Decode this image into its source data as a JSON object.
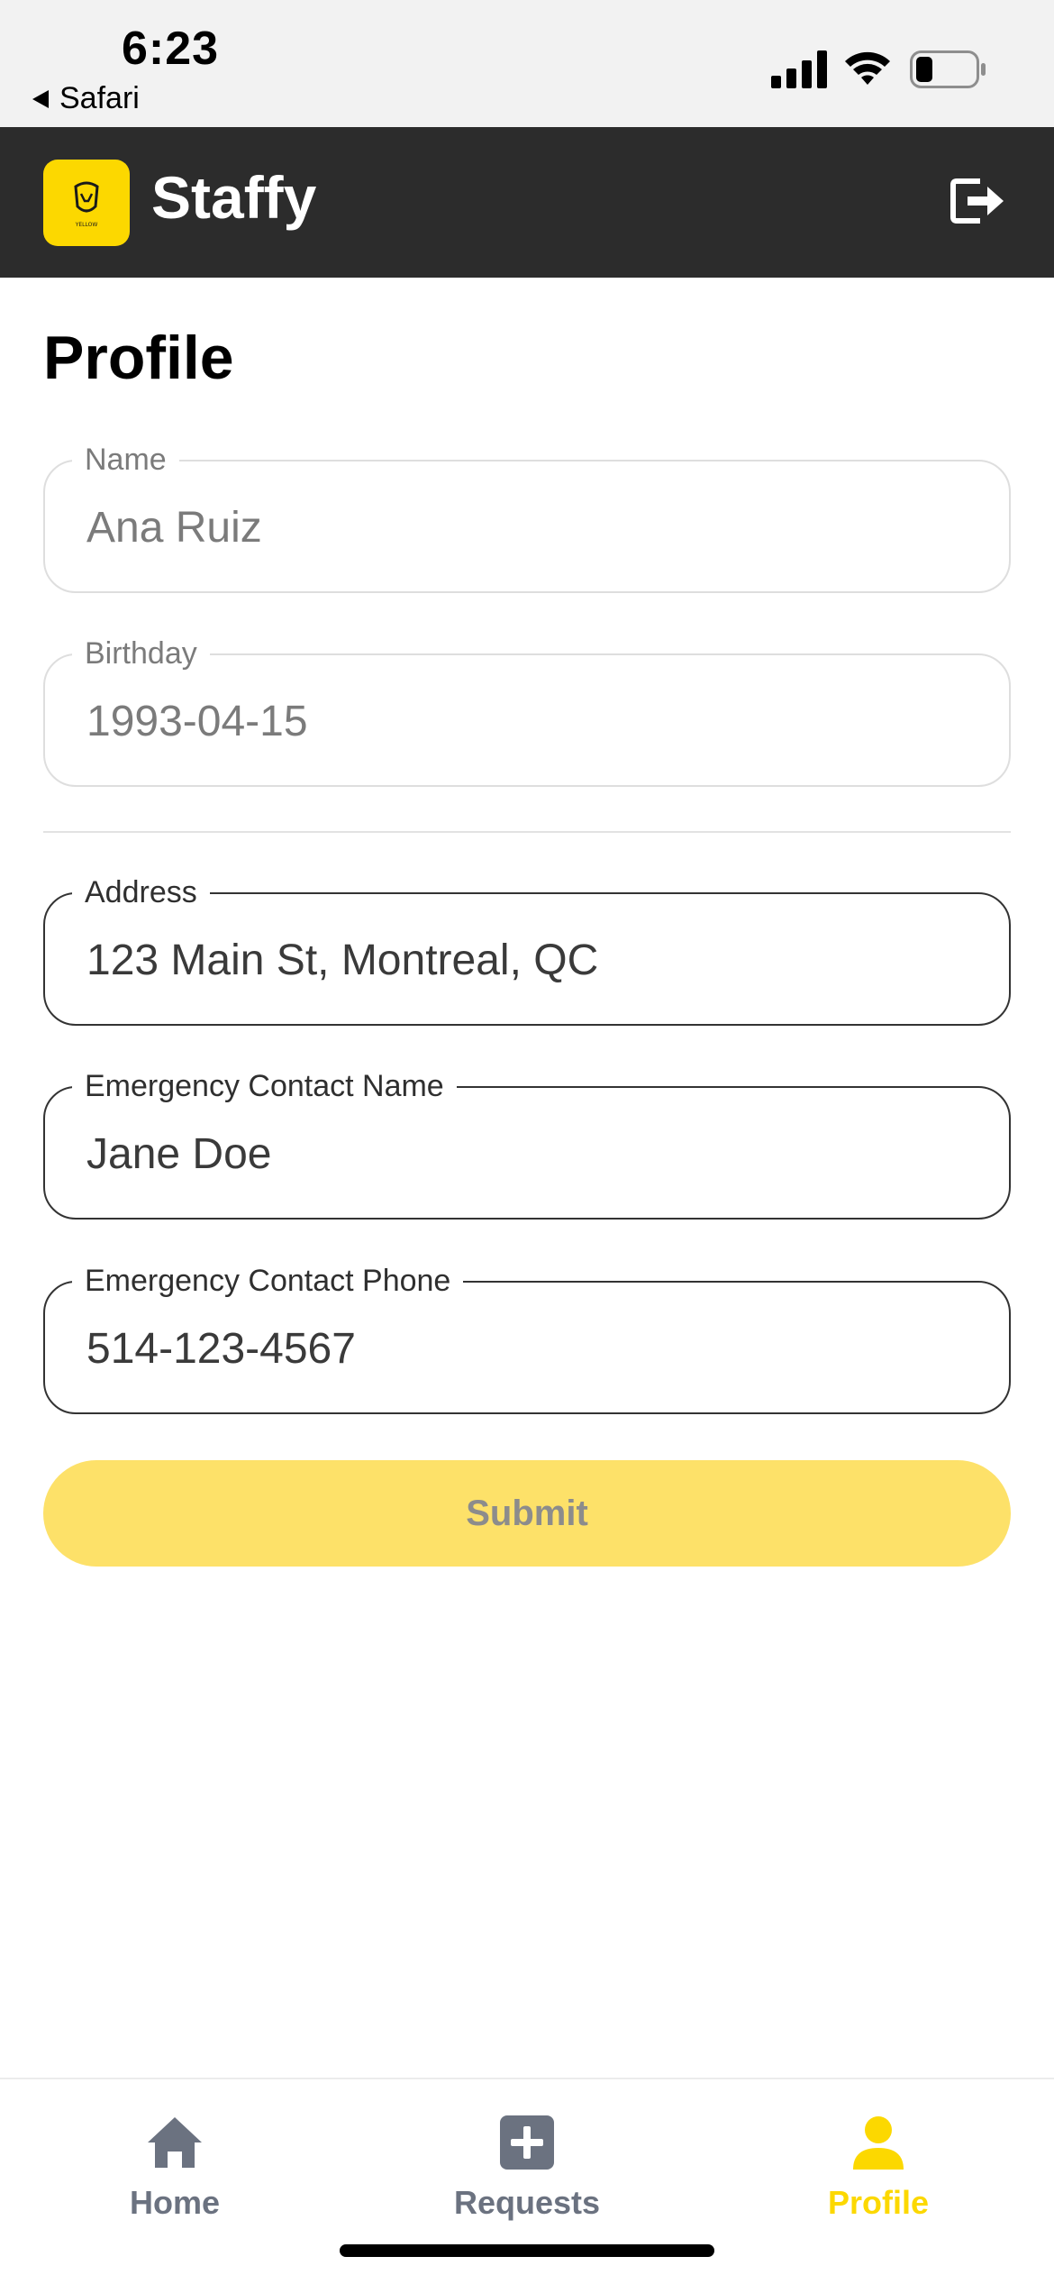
{
  "status_bar": {
    "time": "6:23",
    "back_label": "Safari"
  },
  "app": {
    "name": "Staffy",
    "logo_text": "YELLOW"
  },
  "page": {
    "title": "Profile"
  },
  "form": {
    "name": {
      "label": "Name",
      "value": "Ana Ruiz"
    },
    "birthday": {
      "label": "Birthday",
      "value": "1993-04-15"
    },
    "address": {
      "label": "Address",
      "value": "123 Main St, Montreal, QC"
    },
    "emergency_name": {
      "label": "Emergency Contact Name",
      "value": "Jane Doe"
    },
    "emergency_phone": {
      "label": "Emergency Contact Phone",
      "value": "514-123-4567"
    },
    "submit_label": "Submit"
  },
  "tabs": [
    {
      "label": "Home",
      "icon": "home-icon",
      "active": false
    },
    {
      "label": "Requests",
      "icon": "plus-square-icon",
      "active": false
    },
    {
      "label": "Profile",
      "icon": "user-icon",
      "active": true
    }
  ],
  "colors": {
    "accent": "#fcd800",
    "header_bg": "#2c2c2c",
    "submit_bg": "#fde169",
    "inactive_tab": "#6b7280"
  }
}
